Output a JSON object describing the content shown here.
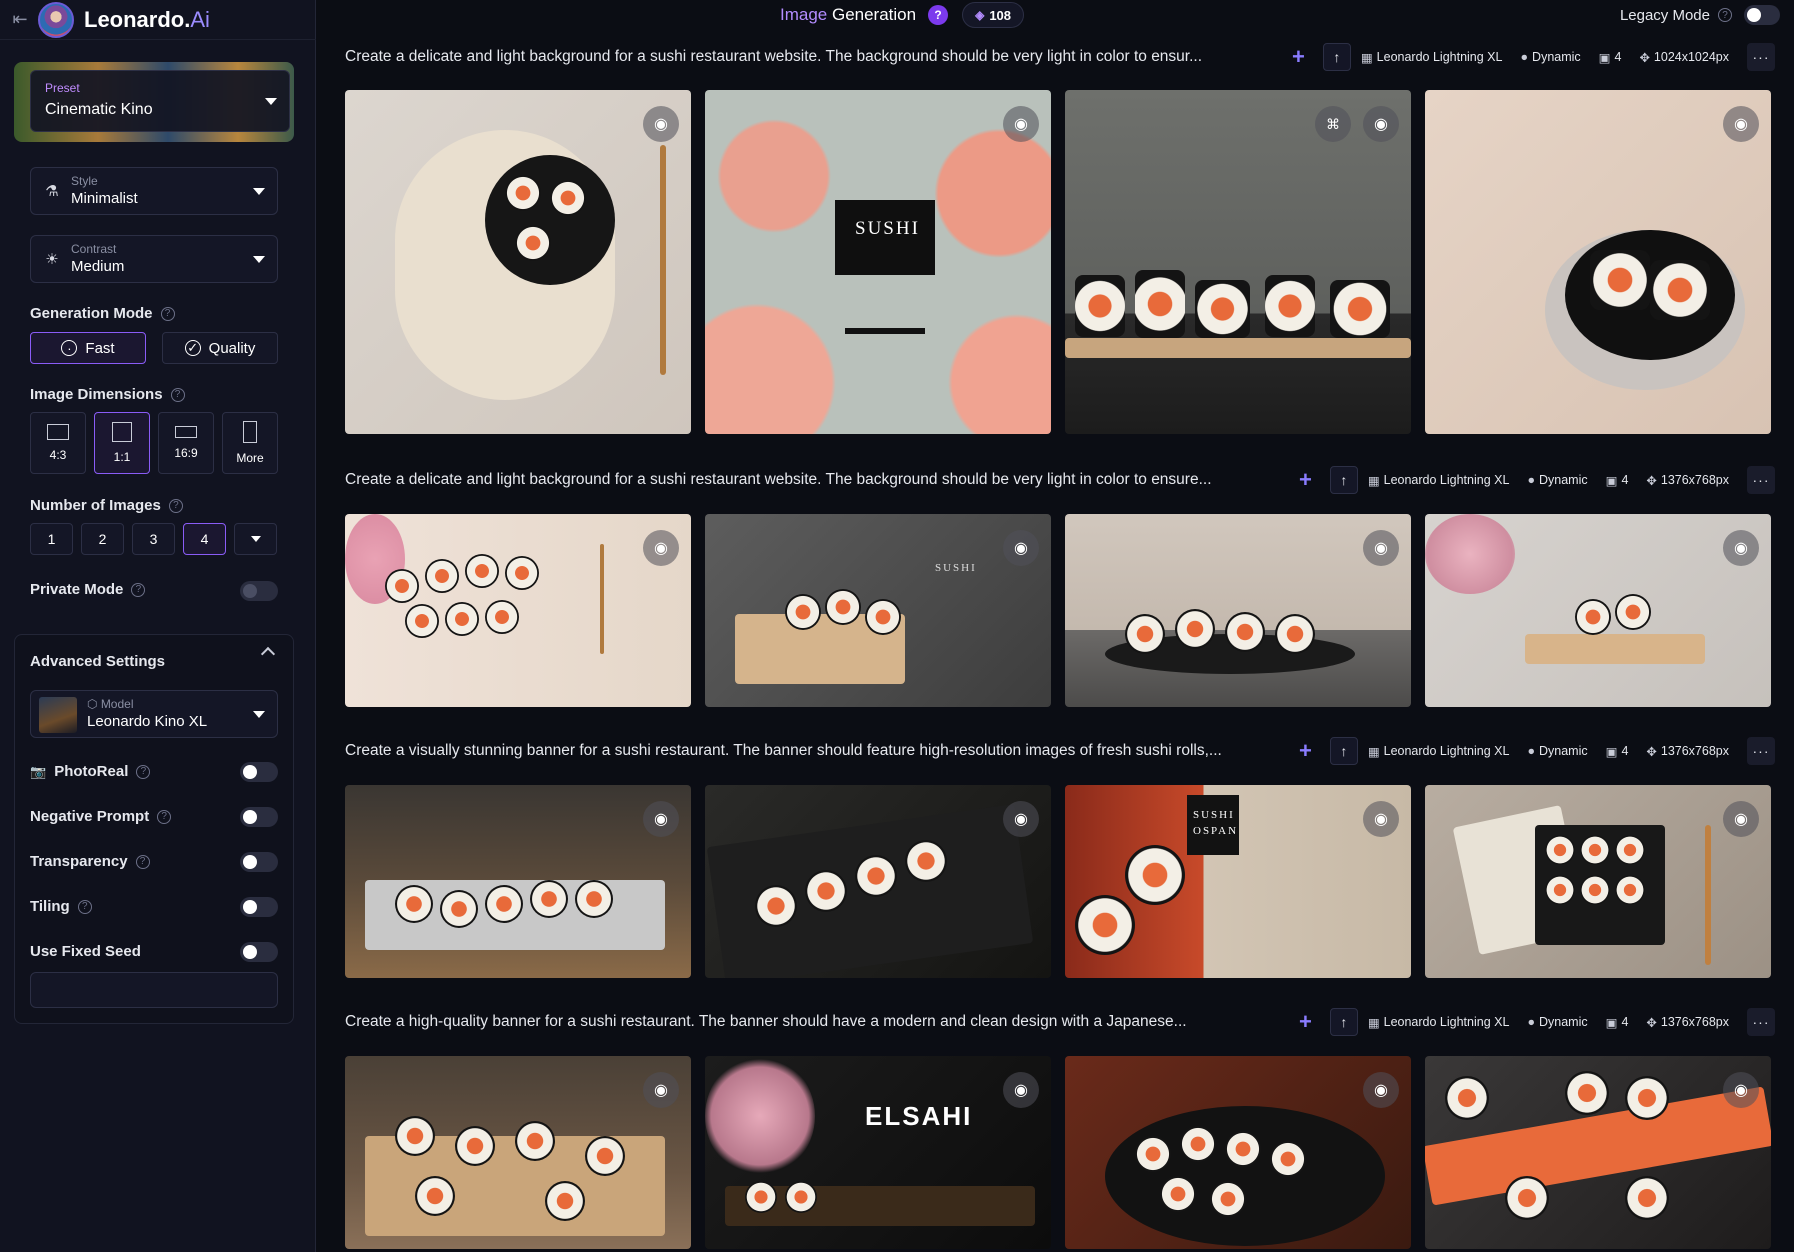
{
  "brand": {
    "name": "Leonardo.",
    "suffix": "Ai"
  },
  "header": {
    "title_prefix": "Image",
    "title_main": " Generation",
    "tokens": "108",
    "legacy_label": "Legacy Mode"
  },
  "preset": {
    "label": "Preset",
    "value": "Cinematic Kino"
  },
  "style": {
    "label": "Style",
    "value": "Minimalist"
  },
  "contrast": {
    "label": "Contrast",
    "value": "Medium"
  },
  "generation_mode": {
    "title": "Generation Mode",
    "options": [
      "Fast",
      "Quality"
    ],
    "selected": "Fast"
  },
  "dimensions": {
    "title": "Image Dimensions",
    "options": [
      "4:3",
      "1:1",
      "16:9",
      "More"
    ],
    "selected": "1:1"
  },
  "num_images": {
    "title": "Number of Images",
    "options": [
      "1",
      "2",
      "3",
      "4"
    ],
    "selected": "4"
  },
  "private_mode": {
    "label": "Private Mode"
  },
  "advanced": {
    "title": "Advanced Settings",
    "model_label": "Model",
    "model_value": "Leonardo Kino XL",
    "toggles": [
      "PhotoReal",
      "Negative Prompt",
      "Transparency",
      "Tiling",
      "Use Fixed Seed"
    ]
  },
  "generations": [
    {
      "prompt": "Create a delicate and light background for a sushi restaurant website. The background should be very light in color to ensur...",
      "model": "Leonardo Lightning XL",
      "style": "Dynamic",
      "count": "4",
      "size": "1024x1024px"
    },
    {
      "prompt": "Create a delicate and light background for a sushi restaurant website. The background should be very light in color to ensure...",
      "model": "Leonardo Lightning XL",
      "style": "Dynamic",
      "count": "4",
      "size": "1376x768px"
    },
    {
      "prompt": "Create a visually stunning banner for a sushi restaurant. The banner should feature high-resolution images of fresh sushi rolls,...",
      "model": "Leonardo Lightning XL",
      "style": "Dynamic",
      "count": "4",
      "size": "1376x768px"
    },
    {
      "prompt": "Create a high-quality banner for a sushi restaurant. The banner should have a modern and clean design with a Japanese...",
      "model": "Leonardo Lightning XL",
      "style": "Dynamic",
      "count": "4",
      "size": "1376x768px"
    }
  ],
  "image_text": {
    "sushi_card": "SUSHI",
    "sushi_label": "SUSHI",
    "sushi_ospan": "SUSHI OSPAN",
    "elsahi": "ELSAHI"
  }
}
